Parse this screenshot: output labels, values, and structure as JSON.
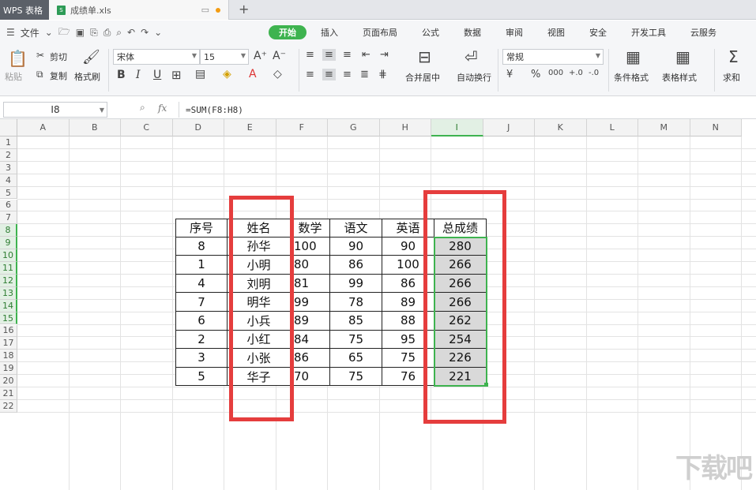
{
  "titlebar": {
    "app_tab": "WPS 表格",
    "file_tab": "成绩单.xls"
  },
  "menubar": {
    "file_menu": "文件",
    "tabs": [
      "开始",
      "插入",
      "页面布局",
      "公式",
      "数据",
      "审阅",
      "视图",
      "安全",
      "开发工具",
      "云服务"
    ],
    "active_tab": "开始"
  },
  "ribbon": {
    "paste": "粘贴",
    "cut": "剪切",
    "copy": "复制",
    "format_painter": "格式刷",
    "font_name": "宋体",
    "font_size": "15",
    "merge_center": "合并居中",
    "wrap_text": "自动换行",
    "number_format": "常规",
    "conditional_format": "条件格式",
    "table_style": "表格样式",
    "sum": "求和"
  },
  "formula_bar": {
    "name_box": "I8",
    "fx": "fx",
    "formula": "=SUM(F8:H8)"
  },
  "sheet": {
    "columns": [
      "A",
      "B",
      "C",
      "D",
      "E",
      "F",
      "G",
      "H",
      "I",
      "J",
      "K",
      "L",
      "M",
      "N"
    ],
    "rows": [
      "1",
      "2",
      "3",
      "4",
      "5",
      "6",
      "7",
      "8",
      "9",
      "10",
      "11",
      "12",
      "13",
      "14",
      "15",
      "16",
      "17",
      "18",
      "19",
      "20",
      "21",
      "22"
    ],
    "selected_column": "I",
    "table_header": [
      "序号",
      "姓名",
      "数学",
      "语文",
      "英语",
      "总成绩"
    ],
    "table_rows": [
      [
        "8",
        "孙华",
        "100",
        "90",
        "90",
        "280"
      ],
      [
        "1",
        "小明",
        "80",
        "86",
        "100",
        "266"
      ],
      [
        "4",
        "刘明",
        "81",
        "99",
        "86",
        "266"
      ],
      [
        "7",
        "明华",
        "99",
        "78",
        "89",
        "266"
      ],
      [
        "6",
        "小兵",
        "89",
        "85",
        "88",
        "262"
      ],
      [
        "2",
        "小红",
        "84",
        "75",
        "95",
        "254"
      ],
      [
        "3",
        "小张",
        "86",
        "65",
        "75",
        "226"
      ],
      [
        "5",
        "华子",
        "70",
        "75",
        "76",
        "221"
      ]
    ]
  },
  "colors": {
    "accent": "#3eb34f",
    "highlight_box": "#e53d3d"
  }
}
